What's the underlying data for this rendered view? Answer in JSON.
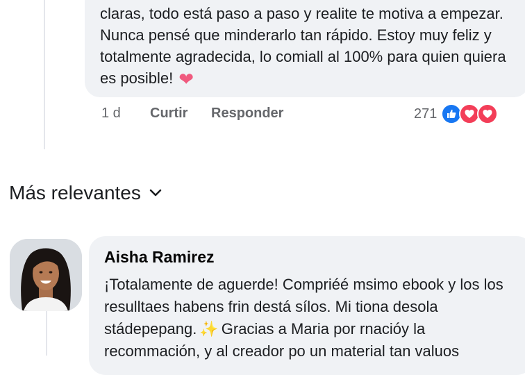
{
  "top_comment": {
    "text": "claras, todo está paso a paso y realite te motiva a empezar. Nunca pensé que minderarlo tan rápido. Estoy muy feliz y totalmente agradecida, lo comiall al 100% para quien quiera es posible!",
    "emoji": "heart-emoji",
    "time": "1 d",
    "like_label": "Curtir",
    "reply_label": "Responder",
    "reaction_count": "271",
    "reactions": [
      "like-icon",
      "love-icon",
      "love-icon"
    ]
  },
  "sort": {
    "label": "Más relevantes",
    "icon": "chevron-down-icon"
  },
  "second_comment": {
    "author": "Aisha Ramirez",
    "text_before": "¡Totalamente de aguerde! Compriéé msimo ebook y los los resulltaes habens frin destá sílos. Mi tiona desola stádepepang.",
    "text_after": "Gracias a Maria por rnacióy la recommación, y al creador po un material tan valuos",
    "emoji": "sparkles-emoji"
  },
  "colors": {
    "bubble": "#f0f2f5",
    "meta_text": "#65676b",
    "like_blue": "#1877f2",
    "love_red": "#f33e58"
  }
}
